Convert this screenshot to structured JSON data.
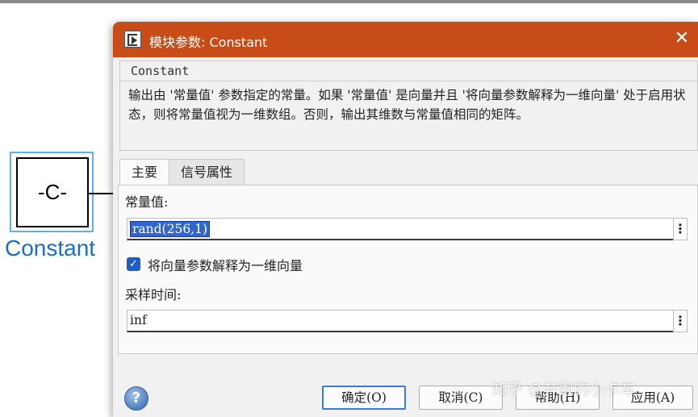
{
  "canvas": {
    "block_text": "-C-",
    "block_label": "Constant"
  },
  "dialog": {
    "title": "模块参数: Constant",
    "close_glyph": "✕",
    "description": {
      "heading": "Constant",
      "text": "输出由 '常量值' 参数指定的常量。如果 '常量值' 是向量并且 '将向量参数解释为一维向量' 处于启用状态，则将常量值视为一维数组。否则，输出其维数与常量值相同的矩阵。"
    },
    "tabs": [
      {
        "label": "主要",
        "active": true
      },
      {
        "label": "信号属性",
        "active": false
      }
    ],
    "main": {
      "constant_label": "常量值:",
      "constant_value": "rand(256,1)",
      "interpret_checkbox_label": "将向量参数解释为一维向量",
      "interpret_checked": true,
      "sample_time_label": "采样时间:",
      "sample_time_value": "inf",
      "more_glyph": "⋮"
    },
    "buttons": {
      "help_glyph": "?",
      "ok": "确定(O)",
      "cancel": "取消(C)",
      "help": "帮助(H)",
      "apply": "应用(A)"
    }
  },
  "watermark": "知乎 @奔跑的小卡车",
  "colors": {
    "titlebar": "#c84c18",
    "selection": "#2f68c9",
    "block_label": "#1b6fc0",
    "block_select_border": "#5fb0ea"
  }
}
